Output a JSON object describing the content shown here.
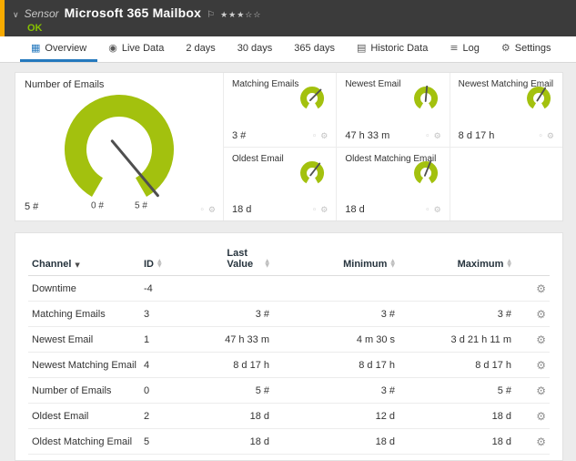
{
  "header": {
    "kind": "Sensor",
    "title": "Microsoft 365 Mailbox",
    "status": "OK",
    "stars": "★★★☆☆"
  },
  "icons": {
    "chevron_down": "∨",
    "flag": "⚐",
    "overview": "▦",
    "live_data": "◉",
    "historic_data": "▤",
    "log": "≡",
    "settings": "⚙",
    "pin": "◦",
    "gear": "⚙",
    "wrench": "⚙"
  },
  "tabs": [
    {
      "label": "Overview",
      "icon": "overview",
      "active": true
    },
    {
      "label": "Live Data",
      "icon": "live_data",
      "active": false
    },
    {
      "label": "2 days",
      "active": false
    },
    {
      "label": "30 days",
      "active": false
    },
    {
      "label": "365 days",
      "active": false
    },
    {
      "label": "Historic Data",
      "icon": "historic_data",
      "active": false
    },
    {
      "label": "Log",
      "icon": "log",
      "active": false
    },
    {
      "label": "Settings",
      "icon": "settings",
      "active": false
    }
  ],
  "gauges": {
    "main": {
      "title": "Number of Emails",
      "value": "5 #",
      "scale_min": "0 #",
      "scale_max": "5 #",
      "needle_deg": 140
    },
    "minis": [
      {
        "title": "Matching Emails",
        "value": "3 #",
        "needle_deg": 45
      },
      {
        "title": "Newest Email",
        "value": "47 h 33 m",
        "needle_deg": 5
      },
      {
        "title": "Newest Matching Email",
        "value": "8 d 17 h",
        "needle_deg": 32
      },
      {
        "title": "Oldest Email",
        "value": "18 d",
        "needle_deg": 38
      },
      {
        "title": "Oldest Matching Email",
        "value": "18 d",
        "needle_deg": 22
      }
    ]
  },
  "table": {
    "columns": [
      {
        "label": "Channel",
        "sort": "desc"
      },
      {
        "label": "ID",
        "sort": "both"
      },
      {
        "label": "Last Value",
        "sort": "both",
        "wrap": true,
        "align": "right"
      },
      {
        "label": "Minimum",
        "sort": "both",
        "align": "right"
      },
      {
        "label": "Maximum",
        "sort": "both",
        "align": "right"
      }
    ],
    "rows": [
      {
        "channel": "Downtime",
        "id": "-4",
        "last": "",
        "min": "",
        "max": ""
      },
      {
        "channel": "Matching Emails",
        "id": "3",
        "last": "3 #",
        "min": "3 #",
        "max": "3 #"
      },
      {
        "channel": "Newest Email",
        "id": "1",
        "last": "47 h 33 m",
        "min": "4 m 30 s",
        "max": "3 d 21 h 11 m"
      },
      {
        "channel": "Newest Matching Email",
        "id": "4",
        "last": "8 d 17 h",
        "min": "8 d 17 h",
        "max": "8 d 17 h"
      },
      {
        "channel": "Number of Emails",
        "id": "0",
        "last": "5 #",
        "min": "3 #",
        "max": "5 #"
      },
      {
        "channel": "Oldest Email",
        "id": "2",
        "last": "18 d",
        "min": "12 d",
        "max": "18 d"
      },
      {
        "channel": "Oldest Matching Email",
        "id": "5",
        "last": "18 d",
        "min": "18 d",
        "max": "18 d"
      }
    ]
  },
  "colors": {
    "green": "#a3c10e",
    "status_ok": "#86c100",
    "stripe_orange": "#f8ab00",
    "tab_active_blue": "#2579be",
    "header_bg": "#3b3b3b"
  }
}
